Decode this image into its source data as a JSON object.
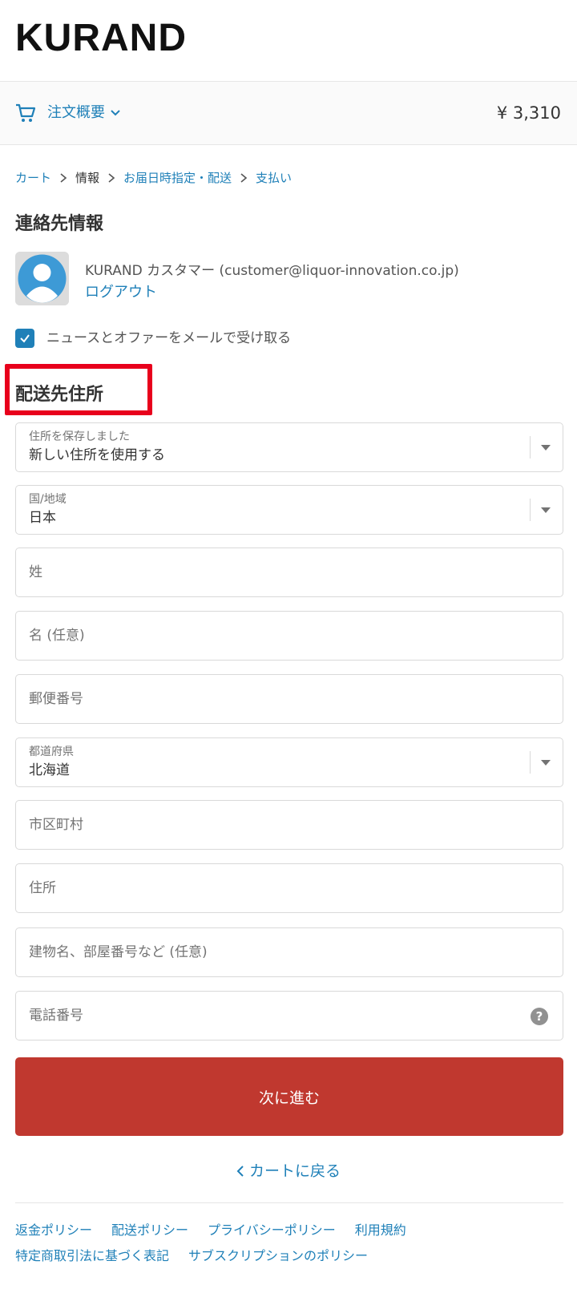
{
  "logo": "KURAND",
  "summary": {
    "toggle_label": "注文概要",
    "total": "¥ 3,310"
  },
  "breadcrumb": [
    {
      "label": "カート"
    },
    {
      "label": "情報"
    },
    {
      "label": "お届日時指定・配送"
    },
    {
      "label": "支払い"
    }
  ],
  "contact": {
    "heading": "連絡先情報",
    "customer": "KURAND カスタマー (customer@liquor-innovation.co.jp)",
    "logout": "ログアウト",
    "newsletter_label": "ニュースとオファーをメールで受け取る",
    "newsletter_checked": true
  },
  "shipping": {
    "heading": "配送先住所",
    "saved_address": {
      "label": "住所を保存しました",
      "value": "新しい住所を使用する"
    },
    "country": {
      "label": "国/地域",
      "value": "日本"
    },
    "last_name": {
      "placeholder": "姓"
    },
    "first_name": {
      "placeholder": "名 (任意)"
    },
    "postal_code": {
      "placeholder": "郵便番号"
    },
    "prefecture": {
      "label": "都道府県",
      "value": "北海道"
    },
    "city": {
      "placeholder": "市区町村"
    },
    "address": {
      "placeholder": "住所"
    },
    "building": {
      "placeholder": "建物名、部屋番号など (任意)"
    },
    "phone": {
      "placeholder": "電話番号",
      "help": "?"
    }
  },
  "actions": {
    "next": "次に進む",
    "back": "カートに戻る"
  },
  "footer": {
    "links": [
      "返金ポリシー",
      "配送ポリシー",
      "プライバシーポリシー",
      "利用規約",
      "特定商取引法に基づく表記",
      "サブスクリプションのポリシー"
    ]
  },
  "colors": {
    "link": "#1f80b8",
    "button": "#c0382f",
    "highlight": "#e8001c"
  }
}
